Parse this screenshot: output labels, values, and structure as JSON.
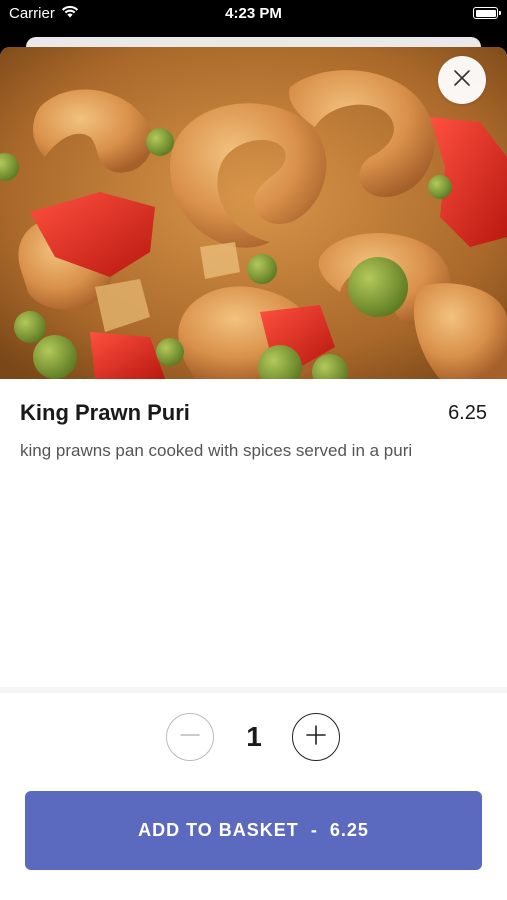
{
  "status_bar": {
    "carrier": "Carrier",
    "time": "4:23 PM"
  },
  "item": {
    "title": "King Prawn Puri",
    "price": "6.25",
    "description": "king prawns pan cooked with spices served in a puri",
    "image_icon": "food-photo"
  },
  "quantity": {
    "value": "1",
    "minus_icon": "minus-icon",
    "plus_icon": "plus-icon"
  },
  "add_button": {
    "label": "ADD TO BASKET",
    "separator": "-",
    "price": "6.25"
  },
  "colors": {
    "accent": "#5b6abf",
    "text": "#1a1a1a",
    "muted": "#555555"
  }
}
